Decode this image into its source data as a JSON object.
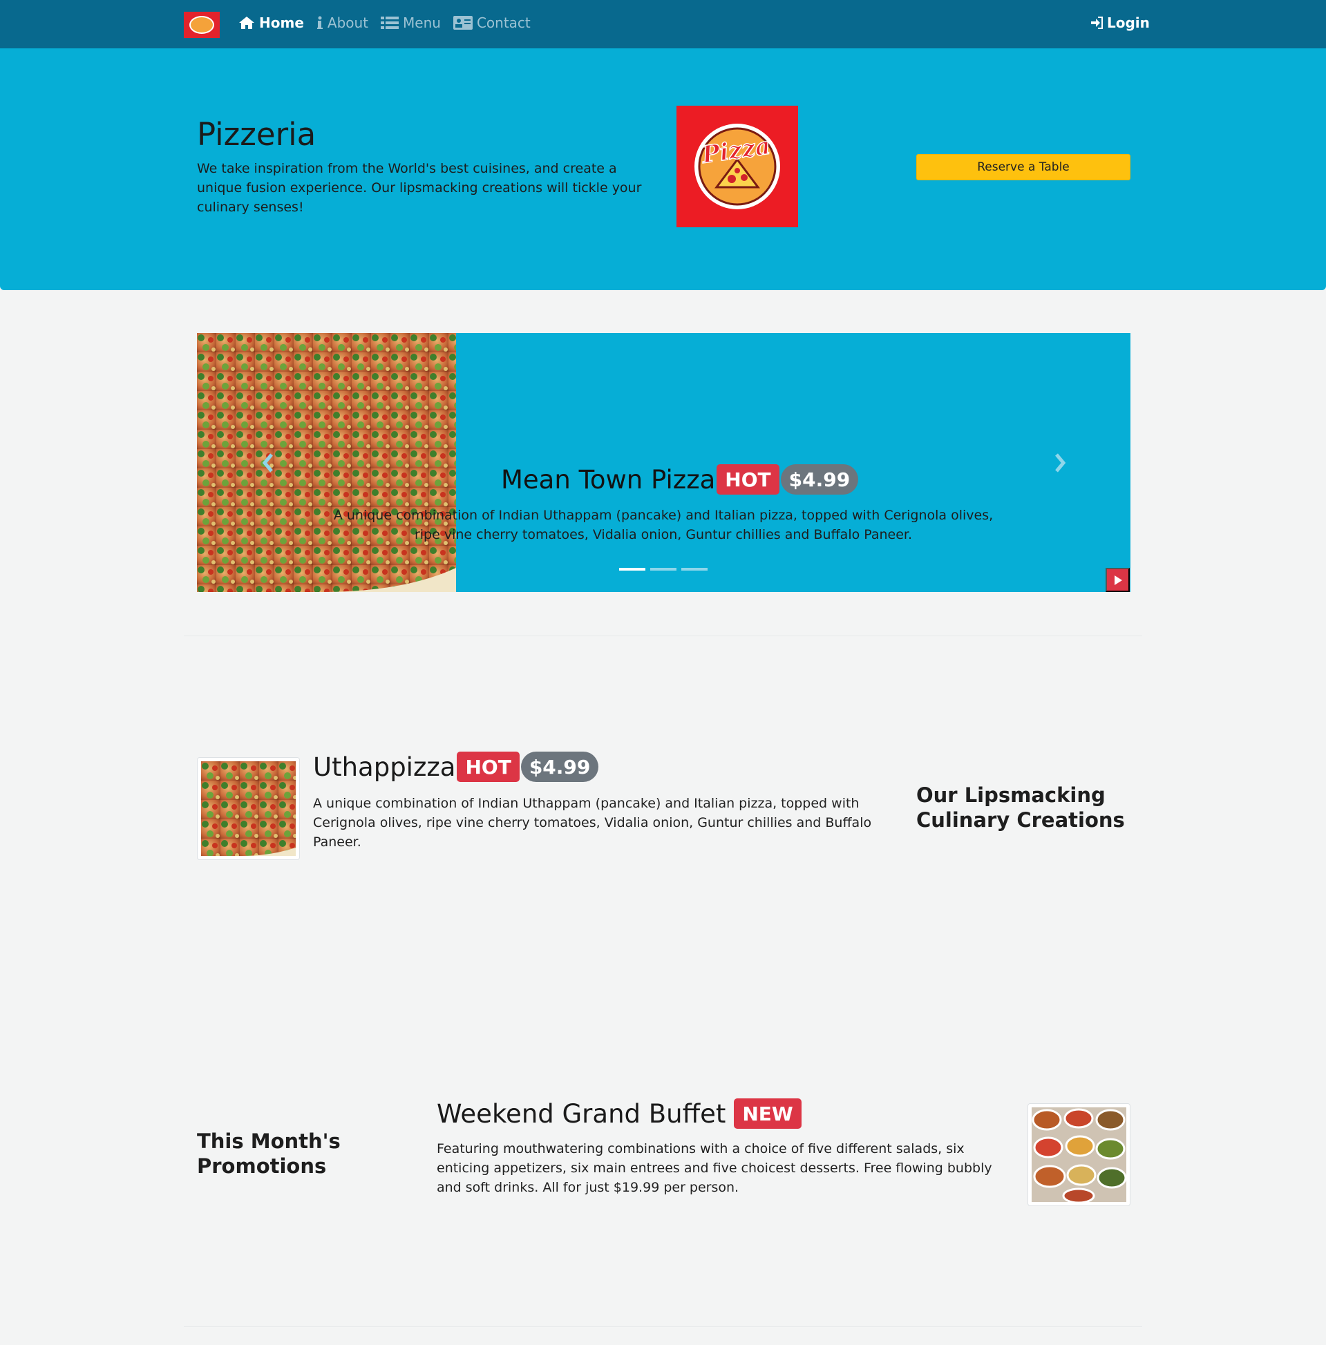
{
  "nav": {
    "items": [
      {
        "label": "Home",
        "icon": "home-icon",
        "active": true
      },
      {
        "label": "About",
        "icon": "info-icon",
        "active": false
      },
      {
        "label": "Menu",
        "icon": "list-icon",
        "active": false
      },
      {
        "label": "Contact",
        "icon": "address-card-icon",
        "active": false
      }
    ],
    "login_label": "Login"
  },
  "jumbotron": {
    "title": "Pizzeria",
    "text": "We take inspiration from the World's best cuisines, and create a unique fusion experience. Our lipsmacking creations will tickle your culinary senses!",
    "logo_text": "Pizza",
    "reserve_label": "Reserve a Table"
  },
  "carousel": {
    "title": "Mean Town Pizza",
    "badge": "HOT",
    "price": "$4.99",
    "text": "A unique combination of Indian Uthappam (pancake) and Italian pizza, topped with Cerignola olives, ripe vine cherry tomatoes, Vidalia onion, Guntur chillies and Buffalo Paneer.",
    "slide_count": 3,
    "active_slide": 1
  },
  "featured": {
    "title": "Uthappizza",
    "badge": "HOT",
    "price": "$4.99",
    "text": "A unique combination of Indian Uthappam (pancake) and Italian pizza, topped with Cerignola olives, ripe vine cherry tomatoes, Vidalia onion, Guntur chillies and Buffalo Paneer.",
    "side_heading": "Our Lipsmacking Culinary Creations"
  },
  "promotion": {
    "side_heading": "This Month's Promotions",
    "title": "Weekend Grand Buffet",
    "badge": "NEW",
    "text": "Featuring mouthwatering combinations with a choice of five different salads, six enticing appetizers, six main entrees and five choicest desserts. Free flowing bubbly and soft drinks. All for just $19.99 per person."
  },
  "colors": {
    "navbar": "#08698e",
    "jumbotron": "#06aed6",
    "accent_button": "#fec10e",
    "badge_hot": "#dc3545",
    "badge_price": "#6c757d"
  }
}
